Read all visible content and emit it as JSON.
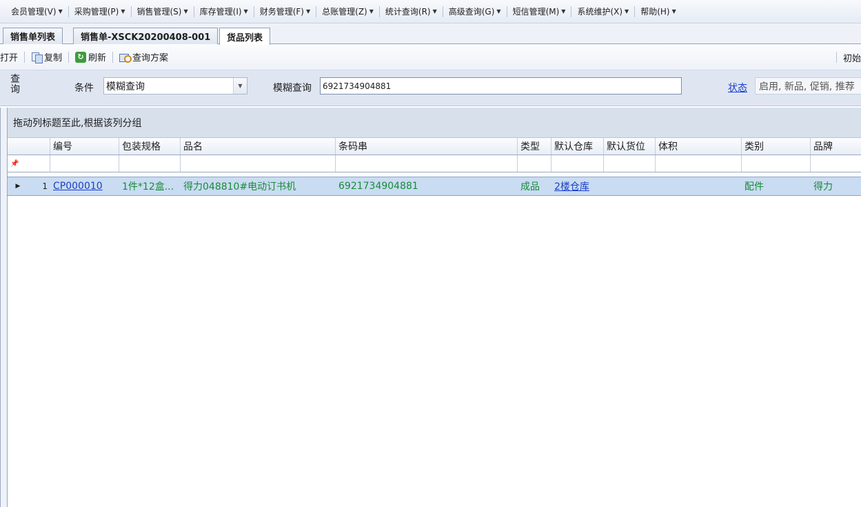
{
  "menu": [
    {
      "label": "会员管理(V)"
    },
    {
      "label": "采购管理(P)"
    },
    {
      "label": "销售管理(S)"
    },
    {
      "label": "库存管理(I)"
    },
    {
      "label": "财务管理(F)"
    },
    {
      "label": "总账管理(Z)"
    },
    {
      "label": "统计查询(R)"
    },
    {
      "label": "高级查询(G)"
    },
    {
      "label": "短信管理(M)"
    },
    {
      "label": "系统维护(X)"
    },
    {
      "label": "帮助(H)"
    }
  ],
  "tabs": [
    {
      "label": "销售单列表"
    },
    {
      "label": "销售单-XSCK20200408-001"
    },
    {
      "label": "货品列表"
    }
  ],
  "toolbar": {
    "open_label": "打开",
    "copy_label": "复制",
    "refresh_label": "刷新",
    "query_plan_label": "查询方案",
    "right_label": "初始"
  },
  "search": {
    "side_label": "查询",
    "condition_label": "条件",
    "condition_value": "模糊查询",
    "fuzzy_label": "模糊查询",
    "fuzzy_value": "6921734904881",
    "status_link": "状态",
    "status_value": "启用, 新品, 促销, 推荐"
  },
  "grid": {
    "group_hint": "拖动列标题至此,根据该列分组",
    "columns": [
      "编号",
      "包装规格",
      "品名",
      "条码串",
      "类型",
      "默认仓库",
      "默认货位",
      "体积",
      "类别",
      "品牌"
    ],
    "rows": [
      {
        "row_no": "1",
        "code": "CP000010",
        "package": "1件*12盒...",
        "name": "得力048810#电动订书机",
        "barcode": "6921734904881",
        "type": "成品",
        "warehouse": "2楼仓库",
        "location": "",
        "volume": "",
        "category": "配件",
        "brand": "得力"
      }
    ]
  }
}
